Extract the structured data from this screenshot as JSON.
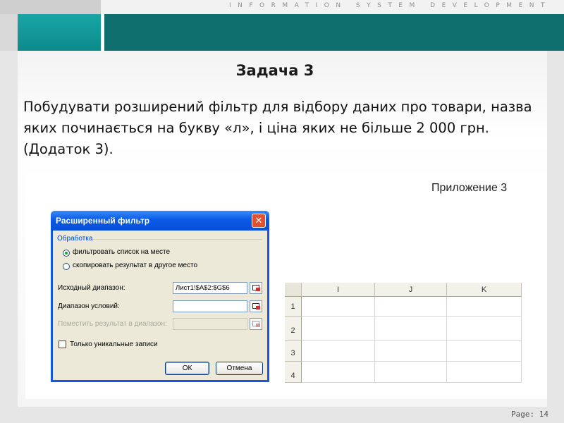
{
  "slide": {
    "brand": "INFORMATION SYSTEM DEVELOPMENT",
    "title": "Задача 3",
    "body": "Побудувати розширений фільтр для відбору даних про товари, назва яких починається на букву «л», і ціна яких не більше 2 000 грн. (Додаток 3).",
    "page_label": "Page: 14",
    "appendix_label": "Приложение 3"
  },
  "dialog": {
    "title": "Расширенный фильтр",
    "group_label": "Обработка",
    "options": [
      {
        "label": "фильтровать список на месте",
        "selected": true
      },
      {
        "label": "скопировать результат в другое место",
        "selected": false
      }
    ],
    "fields": {
      "source_label": "Исходный диапазон:",
      "source_value": "Лист1!$A$2:$G$6",
      "criteria_label": "Диапазон условий:",
      "criteria_value": "",
      "target_label": "Поместить результат в диапазон:",
      "target_value": ""
    },
    "unique_label": "Только уникальные записи",
    "unique_checked": false,
    "ok_label": "ОК",
    "cancel_label": "Отмена"
  },
  "spreadsheet": {
    "columns": [
      "I",
      "J",
      "K"
    ],
    "rows": [
      "1",
      "2",
      "3",
      "4"
    ]
  },
  "colors": {
    "teal_bar": "#0f6e6e",
    "teal_accent": "#19a6a6",
    "dialog_title": "#0a5ae6",
    "dialog_face": "#ece9d8"
  }
}
